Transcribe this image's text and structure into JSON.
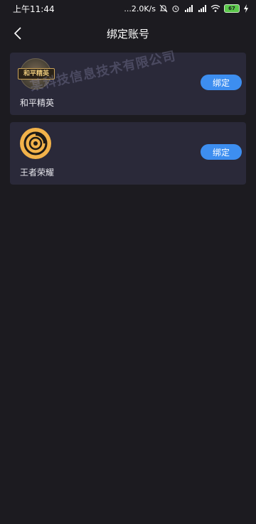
{
  "status_bar": {
    "time": "上午11:44",
    "network_speed": "...2.0K/s",
    "battery_level": "67",
    "icons": [
      "mute-icon",
      "alarm-icon",
      "signal-hd-icon",
      "signal-hd-icon",
      "wifi-icon",
      "battery-icon",
      "charging-icon"
    ]
  },
  "nav": {
    "title": "绑定账号",
    "back_icon": "back-chevron-icon"
  },
  "accounts": [
    {
      "name": "和平精英",
      "icon_text": "和平精英",
      "button_label": "绑定"
    },
    {
      "name": "王者荣耀",
      "button_label": "绑定"
    }
  ],
  "watermark": "某科技信息技术有限公司",
  "colors": {
    "background": "#1c1b20",
    "card": "#2a2939",
    "accent": "#3d8ef0"
  }
}
